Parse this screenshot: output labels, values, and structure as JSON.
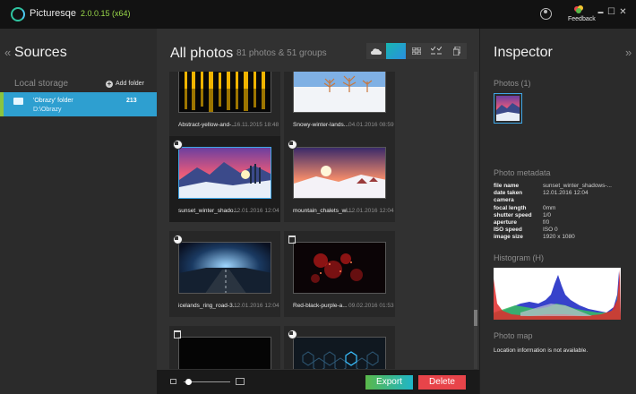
{
  "app": {
    "name": "Picturesqe",
    "version": "2.0.0.15 (x64)",
    "feedback_label": "Feedback",
    "window_controls": {
      "minimize": "▬",
      "maximize": "☐",
      "close": "✕"
    }
  },
  "sources": {
    "title": "Sources",
    "collapse_icon": "«",
    "local_storage_label": "Local storage",
    "add_folder_label": "Add folder",
    "folder": {
      "name": "'Obrazy' folder",
      "path": "D:\\Obrazy",
      "count": "213"
    }
  },
  "main": {
    "title": "All photos",
    "subtitle": "81 photos & 51 groups",
    "view_buttons": [
      "cloud-view-icon",
      "grid-large-icon",
      "grid-small-icon",
      "compare-icon",
      "duplicates-icon"
    ],
    "tiles": [
      {
        "name": "Abstract-yellow-and-...",
        "date": "16.11.2015 18:48",
        "image": "abstract-yellow"
      },
      {
        "name": "Snowy-winter-lands...",
        "date": "04.01.2016 08:59",
        "image": "snowy-winter"
      },
      {
        "name": "sunset_winter_shado...",
        "date": "12.01.2016 12:04",
        "image": "sunset-winter",
        "selected": true
      },
      {
        "name": "mountain_chalets_wi...",
        "date": "12.01.2016 12:04",
        "image": "mountain-chalets"
      },
      {
        "name": "icelands_ring_road-3...",
        "date": "12.01.2016 12:04",
        "image": "icelands-road"
      },
      {
        "name": "Red-black-purple-a...",
        "date": "09.02.2016 01:53",
        "image": "red-black-purple"
      },
      {
        "name": "",
        "date": "",
        "image": "black"
      },
      {
        "name": "",
        "date": "",
        "image": "hexagons"
      }
    ],
    "export_label": "Export",
    "delete_label": "Delete"
  },
  "inspector": {
    "title": "Inspector",
    "expand_icon": "»",
    "photos_label": "Photos (1)",
    "metadata_label": "Photo metadata",
    "metadata": [
      {
        "key": "file name",
        "value": "sunset_winter_shadows-..."
      },
      {
        "key": "date taken",
        "value": "12.01.2016 12:04"
      },
      {
        "key": "camera",
        "value": ""
      },
      {
        "key": "focal length",
        "value": "0mm"
      },
      {
        "key": "shutter speed",
        "value": "1/0"
      },
      {
        "key": "aperture",
        "value": "f/0"
      },
      {
        "key": "ISO speed",
        "value": "ISO 0"
      },
      {
        "key": "image size",
        "value": "1920 x 1080"
      }
    ],
    "histogram_label": "Histogram (H)",
    "map_label": "Photo map",
    "map_text": "Location information is not available."
  }
}
